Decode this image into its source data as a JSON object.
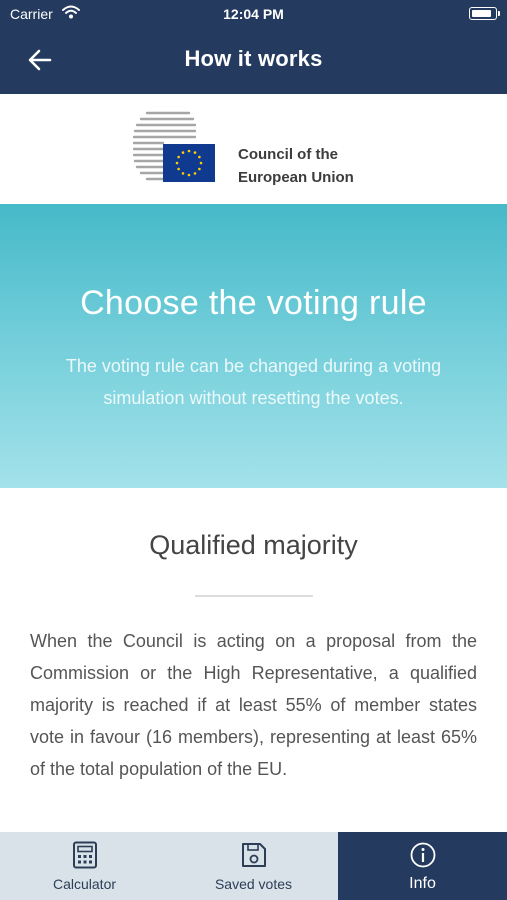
{
  "status_bar": {
    "carrier": "Carrier",
    "time": "12:04 PM"
  },
  "header": {
    "title": "How it works",
    "back_icon": "arrow-left-icon"
  },
  "logo": {
    "line1": "Council of the",
    "line2": "European Union"
  },
  "hero": {
    "title": "Choose the voting rule",
    "subtitle": "The voting rule can be changed during a voting simulation without resetting the votes."
  },
  "section": {
    "title": "Qualified majority",
    "body": "When the Council is acting on a proposal from the Commission or the High Representative, a qualified majority is reached if at least 55% of member states vote in favour (16 members), representing at least 65% of the total population of the EU."
  },
  "tabs": [
    {
      "label": "Calculator",
      "icon": "calculator-icon",
      "active": false
    },
    {
      "label": "Saved votes",
      "icon": "save-icon",
      "active": false
    },
    {
      "label": "Info",
      "icon": "info-icon",
      "active": true
    }
  ],
  "colors": {
    "navy": "#243a5e",
    "teal": "#46b9c9",
    "eu_blue": "#0f3a8f",
    "eu_yellow": "#ffd000",
    "tab_inactive": "#d9e2e9"
  }
}
